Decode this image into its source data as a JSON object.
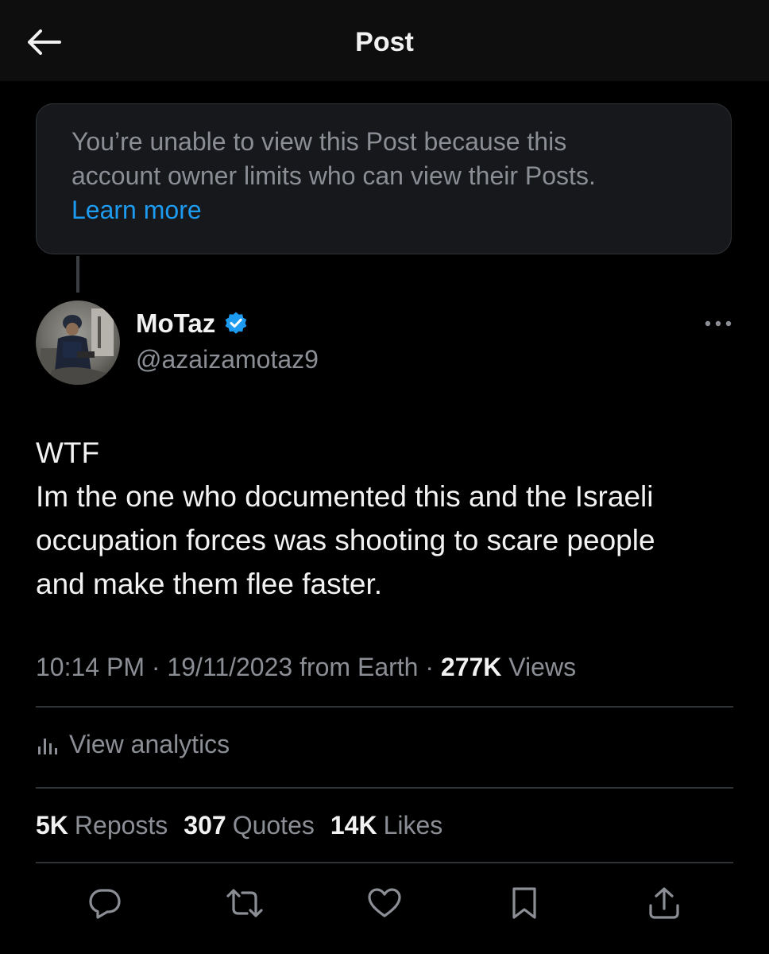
{
  "header": {
    "title": "Post",
    "back_icon": "arrow-left-icon"
  },
  "notice": {
    "text_line1": "You’re unable to view this Post because this",
    "text_line2": "account owner limits who can view their Posts.",
    "link_label": "Learn more",
    "link_color": "#1d9bf0"
  },
  "author": {
    "display_name": "MoTaz",
    "handle": "@azaizamotaz9",
    "verified_icon": "verified-badge-icon",
    "verified_color": "#1d9bf0"
  },
  "post": {
    "lines": [
      "WTF",
      "Im the one who documented this and the Israeli",
      "occupation forces was shooting to scare people",
      "and make them flee faster."
    ]
  },
  "meta": {
    "time": "10:14 PM",
    "sep1": " · ",
    "date": "19/11/2023",
    "source": " from Earth",
    "sep2": " · ",
    "views_count": "277K",
    "views_label": " Views"
  },
  "analytics": {
    "label": "View analytics",
    "icon": "analytics-bars-icon"
  },
  "stats": {
    "reposts_count": "5K",
    "reposts_label": "Reposts",
    "quotes_count": "307",
    "quotes_label": "Quotes",
    "likes_count": "14K",
    "likes_label": "Likes"
  },
  "actions": {
    "reply_icon": "reply-icon",
    "repost_icon": "repost-icon",
    "like_icon": "heart-icon",
    "bookmark_icon": "bookmark-icon",
    "share_icon": "share-icon"
  },
  "colors": {
    "background": "#000000",
    "text_primary": "#f2f2f2",
    "text_secondary": "#8b8f95",
    "accent": "#1d9bf0",
    "divider": "#2f3336"
  }
}
